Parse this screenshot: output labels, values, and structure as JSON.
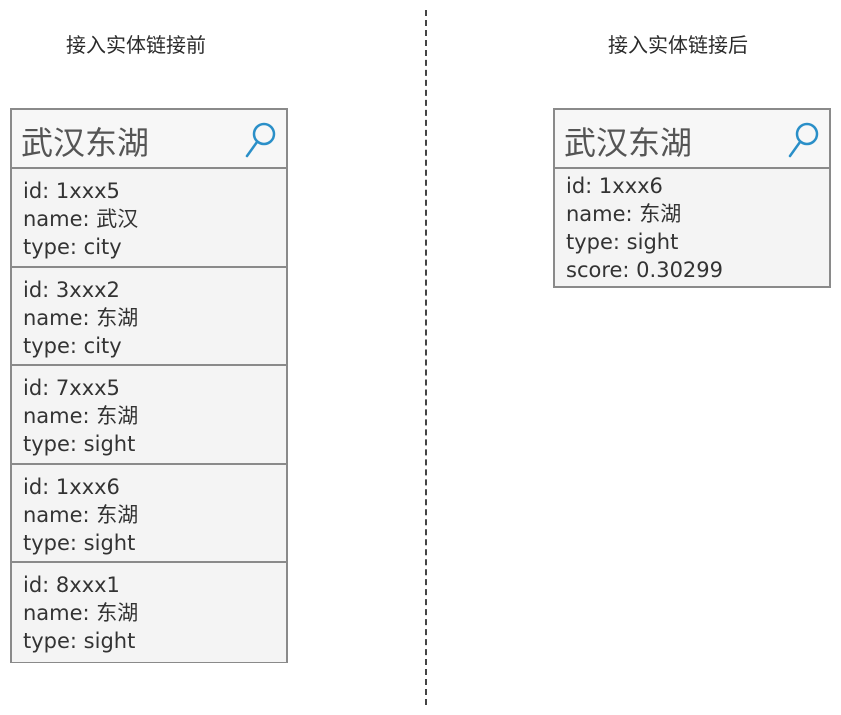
{
  "before": {
    "heading": "接入实体链接前",
    "query": "武汉东湖",
    "results": [
      {
        "id": "id: 1xxx5",
        "name": "name: 武汉",
        "type": "type: city"
      },
      {
        "id": "id: 3xxx2",
        "name": "name: 东湖",
        "type": "type: city"
      },
      {
        "id": "id: 7xxx5",
        "name": "name: 东湖",
        "type": "type: sight"
      },
      {
        "id": "id: 1xxx6",
        "name": "name: 东湖",
        "type": "type: sight"
      },
      {
        "id": "id: 8xxx1",
        "name": "name: 东湖",
        "type": "type: sight"
      }
    ]
  },
  "after": {
    "heading": "接入实体链接后",
    "query": "武汉东湖",
    "result": {
      "id": "id: 1xxx6",
      "name": "name: 东湖",
      "type": "type: sight",
      "score": "score: 0.30299"
    }
  },
  "icons": {
    "search": "search-icon"
  },
  "colors": {
    "panel_border": "#8a8a8a",
    "panel_background": "#f4f4f4",
    "search_icon": "#2a8fc8",
    "divider": "#444444"
  }
}
